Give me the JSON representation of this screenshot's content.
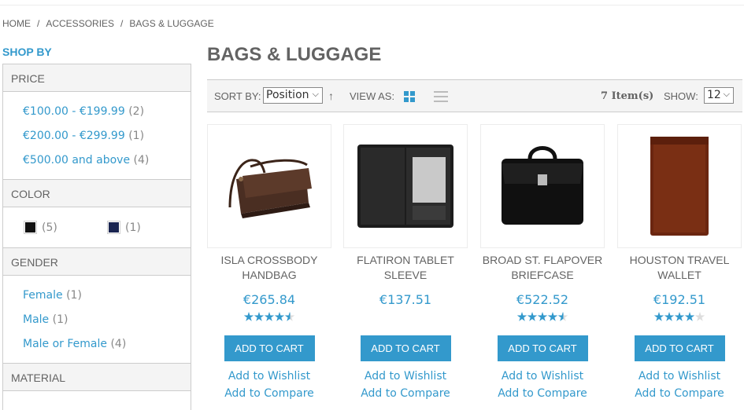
{
  "breadcrumb": {
    "items": [
      "HOME",
      "ACCESSORIES",
      "BAGS & LUGGAGE"
    ],
    "separator": "/"
  },
  "sidebar": {
    "shop_by": "SHOP BY",
    "price": {
      "title": "PRICE",
      "options": [
        {
          "label": "€100.00 - €199.99",
          "count": "(2)"
        },
        {
          "label": "€200.00 - €299.99",
          "count": "(1)"
        },
        {
          "label": "€500.00 and above",
          "count": "(4)"
        }
      ]
    },
    "color": {
      "title": "COLOR",
      "swatches": [
        {
          "color": "#111111",
          "count": "(5)"
        },
        {
          "color": "#1a2550",
          "count": "(1)"
        }
      ]
    },
    "gender": {
      "title": "GENDER",
      "options": [
        {
          "label": "Female",
          "count": "(1)"
        },
        {
          "label": "Male",
          "count": "(1)"
        },
        {
          "label": "Male or Female",
          "count": "(4)"
        }
      ]
    },
    "material": {
      "title": "MATERIAL"
    }
  },
  "page_title": "BAGS & LUGGAGE",
  "toolbar": {
    "sort_label": "SORT BY:",
    "sort_value": "Position",
    "view_label": "VIEW AS:",
    "items_count": "7 Item(s)",
    "show_label": "SHOW:",
    "show_value": "12"
  },
  "products": [
    {
      "name": "ISLA CROSSBODY HANDBAG",
      "price": "€265.84",
      "rating": 4.5,
      "add_to_cart": "ADD TO CART",
      "wishlist": "Add to Wishlist",
      "compare": "Add to Compare",
      "image": "brown-crossbody-bag"
    },
    {
      "name": "FLATIRON TABLET SLEEVE",
      "price": "€137.51",
      "rating": null,
      "add_to_cart": "ADD TO CART",
      "wishlist": "Add to Wishlist",
      "compare": "Add to Compare",
      "image": "black-tablet-sleeve"
    },
    {
      "name": "BROAD ST. FLAPOVER BRIEFCASE",
      "price": "€522.52",
      "rating": 4.5,
      "add_to_cart": "ADD TO CART",
      "wishlist": "Add to Wishlist",
      "compare": "Add to Compare",
      "image": "black-briefcase"
    },
    {
      "name": "HOUSTON TRAVEL WALLET",
      "price": "€192.51",
      "rating": 4,
      "add_to_cart": "ADD TO CART",
      "wishlist": "Add to Wishlist",
      "compare": "Add to Compare",
      "image": "brown-wallet"
    }
  ],
  "colors": {
    "accent": "#3399cc",
    "text": "#636363",
    "star_on": "#3399cc",
    "star_off": "#dddddd"
  }
}
